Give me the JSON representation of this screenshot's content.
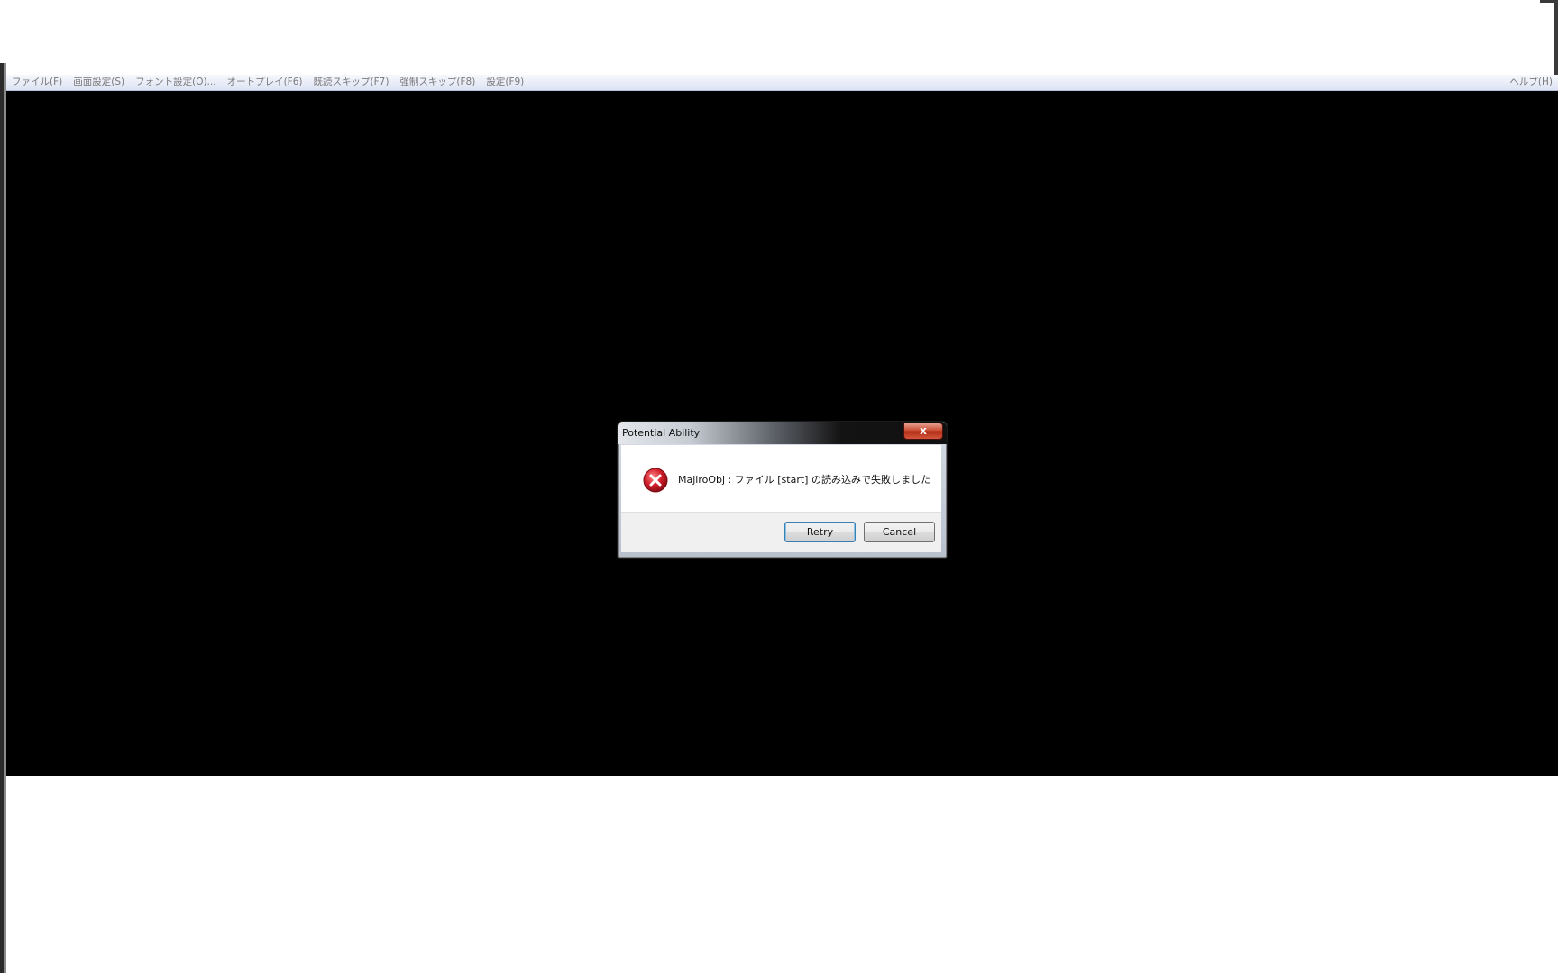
{
  "menubar": {
    "items": [
      "ファイル(F)",
      "画面設定(S)",
      "フォント設定(O)...",
      "オートプレイ(F6)",
      "既読スキップ(F7)",
      "強制スキップ(F8)",
      "設定(F9)"
    ],
    "help": "ヘルプ(H)"
  },
  "dialog": {
    "title": "Potential Ability",
    "close_label": "x",
    "icon": "error-icon",
    "message": "MajiroObj : ファイル [start] の読み込みで失敗しました",
    "buttons": {
      "retry": "Retry",
      "cancel": "Cancel"
    }
  },
  "colors": {
    "game_background": "#000000",
    "error_red": "#d21f2b",
    "close_button": "#c9472f"
  }
}
